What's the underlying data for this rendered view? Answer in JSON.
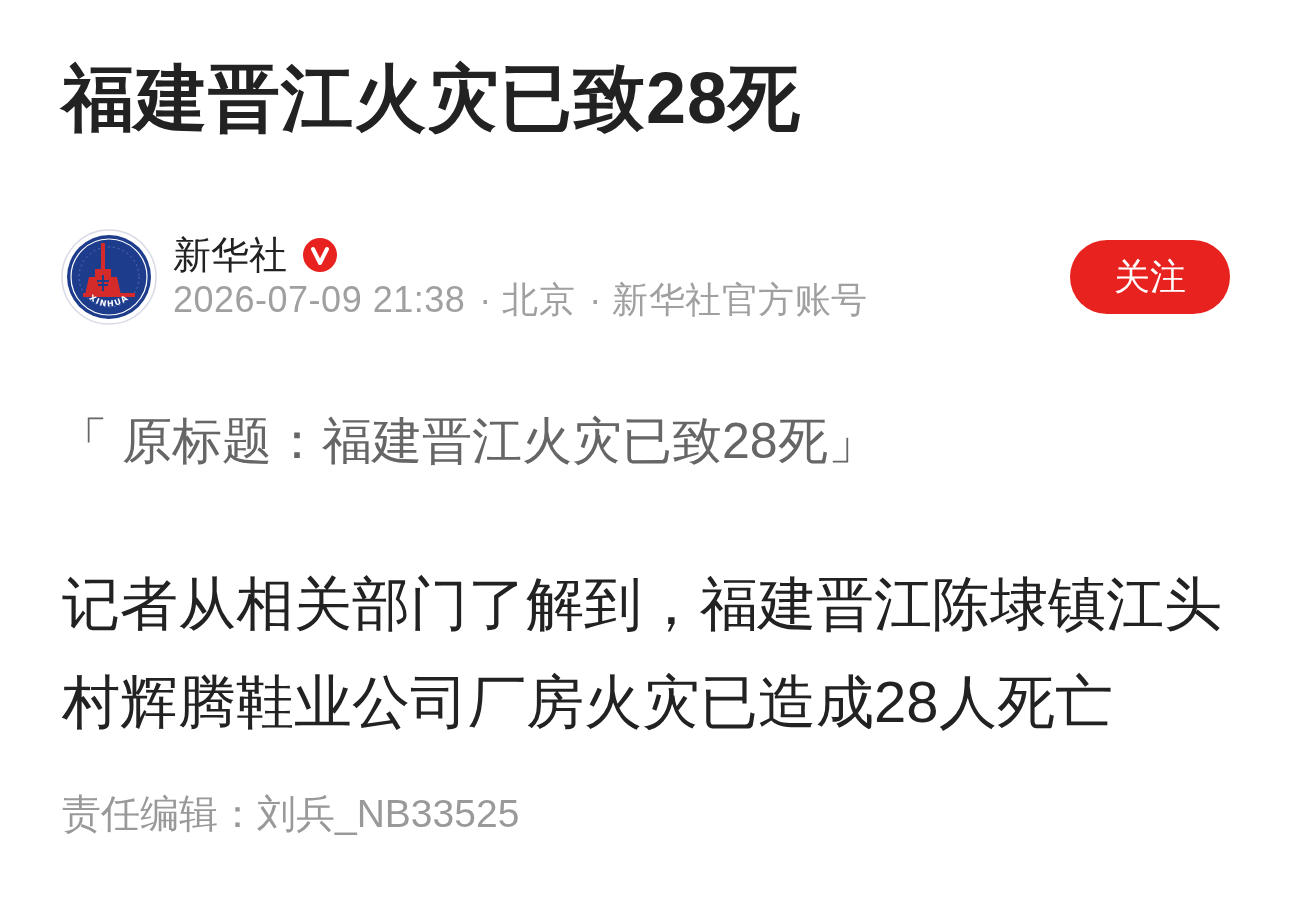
{
  "article": {
    "title": "福建晋江火灾已致28死",
    "author": {
      "name": "新华社",
      "verified": true,
      "avatar_logo_text": "XINHUA",
      "meta": [
        "2026-07-09 21:38",
        "· 北京",
        "· 新华社官方账号"
      ],
      "follow_button": "关注"
    },
    "original_title": "「 原标题：福建晋江火灾已致28死」",
    "body": "记者从相关部门了解到，福建晋江陈埭镇江头村辉腾鞋业公司厂房火灾已造成28人死亡",
    "editor": "责任编辑：刘兵_NB33525"
  }
}
